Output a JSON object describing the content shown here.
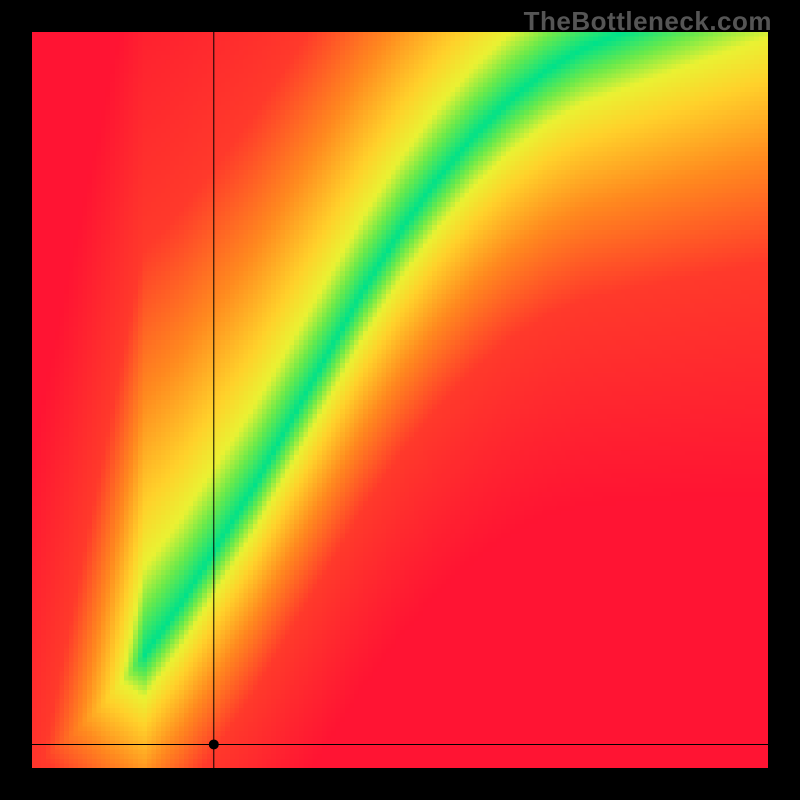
{
  "watermark": "TheBottleneck.com",
  "chart_data": {
    "type": "heatmap",
    "title": "",
    "xlabel": "",
    "ylabel": "",
    "xlim": [
      0,
      1
    ],
    "ylim": [
      0,
      1
    ],
    "grid": false,
    "legend": false,
    "optimal_curve": {
      "description": "Green optimum band (y as function of x, normalized 0..1). Band center passes through these points; band half-width ~0.04–0.08 growing with x.",
      "x": [
        0.0,
        0.05,
        0.1,
        0.15,
        0.2,
        0.25,
        0.3,
        0.35,
        0.4,
        0.45,
        0.5,
        0.55,
        0.6,
        0.65,
        0.7,
        0.75,
        0.8
      ],
      "y": [
        0.0,
        0.04,
        0.09,
        0.15,
        0.22,
        0.3,
        0.38,
        0.47,
        0.56,
        0.65,
        0.73,
        0.8,
        0.86,
        0.91,
        0.95,
        0.98,
        1.0
      ]
    },
    "color_stops": {
      "description": "Piecewise gradient by distance-from-optimal (0=on curve, 1=far)",
      "d": [
        0.0,
        0.06,
        0.12,
        0.2,
        0.35,
        0.55,
        1.0
      ],
      "color": [
        "#00e28a",
        "#6bea4b",
        "#eaf233",
        "#ffd22b",
        "#ff8a1f",
        "#ff3a2b",
        "#ff1433"
      ]
    },
    "marker": {
      "x": 0.247,
      "y": 0.032,
      "crosshair": true
    },
    "resolution": 160
  }
}
